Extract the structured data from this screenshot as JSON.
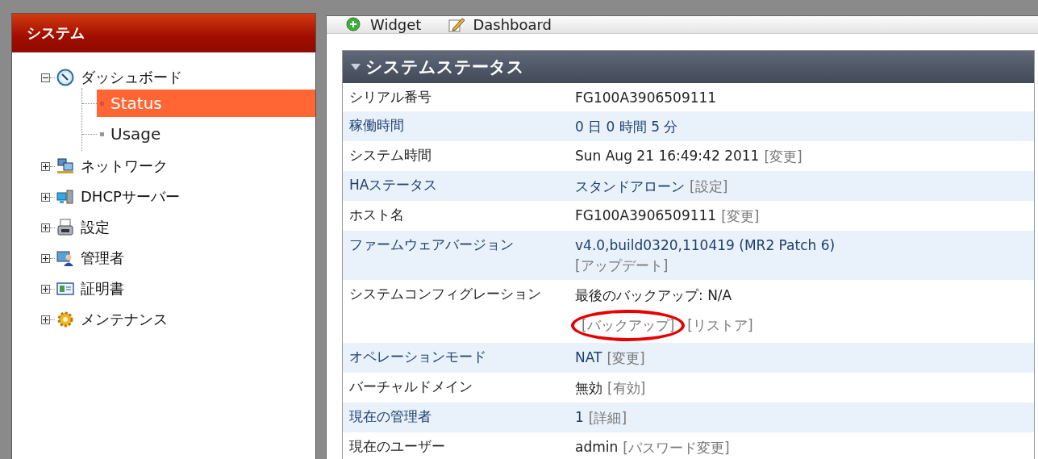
{
  "sidebar": {
    "title": "システム",
    "items": [
      {
        "label": "ダッシュボード",
        "kind": "dashboard",
        "expanded": true,
        "children": [
          {
            "label": "Status",
            "selected": true
          },
          {
            "label": "Usage",
            "selected": false
          }
        ]
      },
      {
        "label": "ネットワーク",
        "kind": "network",
        "expanded": false
      },
      {
        "label": "DHCPサーバー",
        "kind": "server",
        "expanded": false
      },
      {
        "label": "設定",
        "kind": "settings",
        "expanded": false
      },
      {
        "label": "管理者",
        "kind": "admin",
        "expanded": false
      },
      {
        "label": "証明書",
        "kind": "certificate",
        "expanded": false
      },
      {
        "label": "メンテナンス",
        "kind": "maintenance",
        "expanded": false
      }
    ]
  },
  "toolbar": [
    {
      "label": "Widget",
      "kind": "add"
    },
    {
      "label": "Dashboard",
      "kind": "edit"
    }
  ],
  "widget": {
    "title": "システムステータス",
    "expanded": true,
    "rows": [
      {
        "label": "シリアル番号",
        "lines": [
          {
            "text": "FG100A3906509111"
          }
        ]
      },
      {
        "label": "稼働時間",
        "lines": [
          {
            "text": "0 日 0 時間 5 分"
          }
        ]
      },
      {
        "label": "システム時間",
        "lines": [
          {
            "text": "Sun Aug 21 16:49:42 2011",
            "links": [
              {
                "text": "[変更]",
                "circled": false
              }
            ]
          }
        ]
      },
      {
        "label": "HAステータス",
        "lines": [
          {
            "text": "スタンドアローン",
            "links": [
              {
                "text": "[設定]",
                "circled": false
              }
            ]
          }
        ]
      },
      {
        "label": "ホスト名",
        "lines": [
          {
            "text": "FG100A3906509111",
            "links": [
              {
                "text": "[変更]",
                "circled": false
              }
            ]
          }
        ]
      },
      {
        "label": "ファームウェアバージョン",
        "lines": [
          {
            "text": "v4.0,build0320,110419 (MR2 Patch 6)"
          },
          {
            "links": [
              {
                "text": "[アップデート]",
                "circled": false
              }
            ]
          }
        ]
      },
      {
        "label": "システムコンフィグレーション",
        "lines": [
          {
            "text": "最後のバックアップ: N/A"
          },
          {
            "links": [
              {
                "text": "[バックアップ]",
                "circled": true
              },
              {
                "text": "[リストア]",
                "circled": false
              }
            ]
          }
        ]
      },
      {
        "label": "オペレーションモード",
        "lines": [
          {
            "text": "NAT",
            "links": [
              {
                "text": "[変更]",
                "circled": false
              }
            ]
          }
        ]
      },
      {
        "label": "バーチャルドメイン",
        "lines": [
          {
            "text": "無効",
            "links": [
              {
                "text": "[有効]",
                "circled": false
              }
            ]
          }
        ]
      },
      {
        "label": "現在の管理者",
        "lines": [
          {
            "text": "1",
            "links": [
              {
                "text": "[詳細]",
                "circled": false
              }
            ]
          }
        ]
      },
      {
        "label": "現在のユーザー",
        "lines": [
          {
            "text": "admin",
            "links": [
              {
                "text": "[パスワード変更]",
                "circled": false
              }
            ]
          }
        ]
      }
    ]
  }
}
